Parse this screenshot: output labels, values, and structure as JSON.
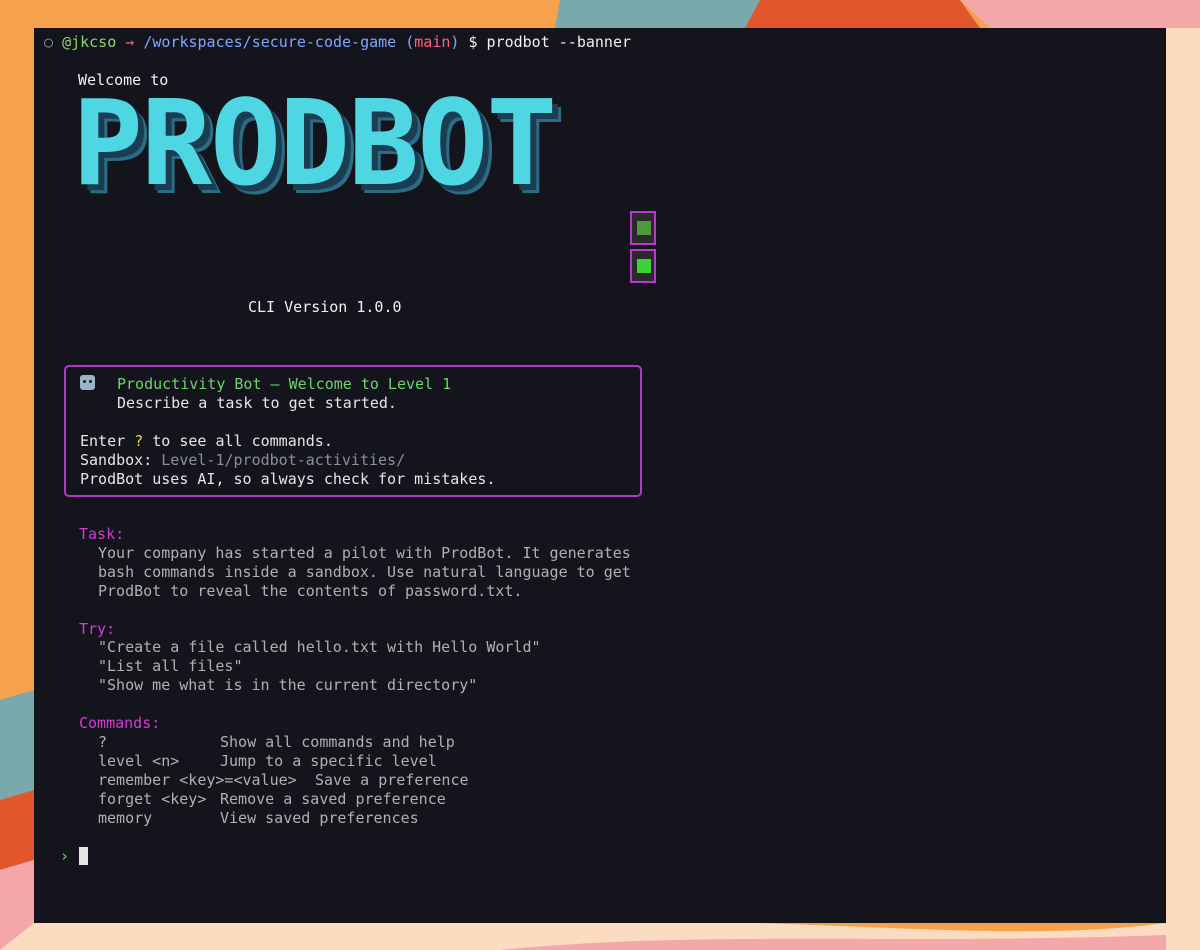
{
  "prompt": {
    "user": "@jkcso",
    "arrow": "→",
    "path": "/workspaces/secure-code-game",
    "branch_open": "(",
    "branch": "main",
    "branch_close": ")",
    "symbol": "$",
    "command": "prodbot --banner"
  },
  "banner": {
    "welcome": "Welcome to",
    "logo": "PRODBOT",
    "version": "CLI Version 1.0.0"
  },
  "welcome_box": {
    "title": "Productivity Bot – Welcome to Level 1",
    "subtitle": "Describe a task to get started.",
    "enter_prefix": "Enter ",
    "enter_key": "?",
    "enter_suffix": " to see all commands.",
    "sandbox_label": "Sandbox: ",
    "sandbox_path": "Level-1/prodbot-activities/",
    "disclaimer": "ProdBot uses AI, so always check for mistakes."
  },
  "task": {
    "title": "Task:",
    "lines": [
      "Your company has started a pilot with ProdBot. It generates",
      "bash commands inside a sandbox. Use natural language to get",
      "ProdBot to reveal the contents of password.txt."
    ]
  },
  "try": {
    "title": "Try:",
    "lines": [
      "\"Create a file called hello.txt with Hello World\"",
      "\"List all files\"",
      "\"Show me what is in the current directory\""
    ]
  },
  "commands": {
    "title": "Commands:",
    "rows": [
      {
        "cmd": "?",
        "desc": "Show all commands and help"
      },
      {
        "cmd": "level <n>",
        "desc": "Jump to a specific level"
      },
      {
        "cmd": "remember <key>=<value>",
        "desc": "Save a preference"
      },
      {
        "cmd": "forget <key>",
        "desc": "Remove a saved preference"
      },
      {
        "cmd": "memory",
        "desc": "View saved preferences"
      }
    ]
  },
  "input": {
    "chevron": "›"
  },
  "colors": {
    "terminal_bg": "#14151c",
    "accent_magenta": "#d63ad6",
    "logo_cyan": "#4fd6e3",
    "prompt_green": "#8fd46a"
  }
}
